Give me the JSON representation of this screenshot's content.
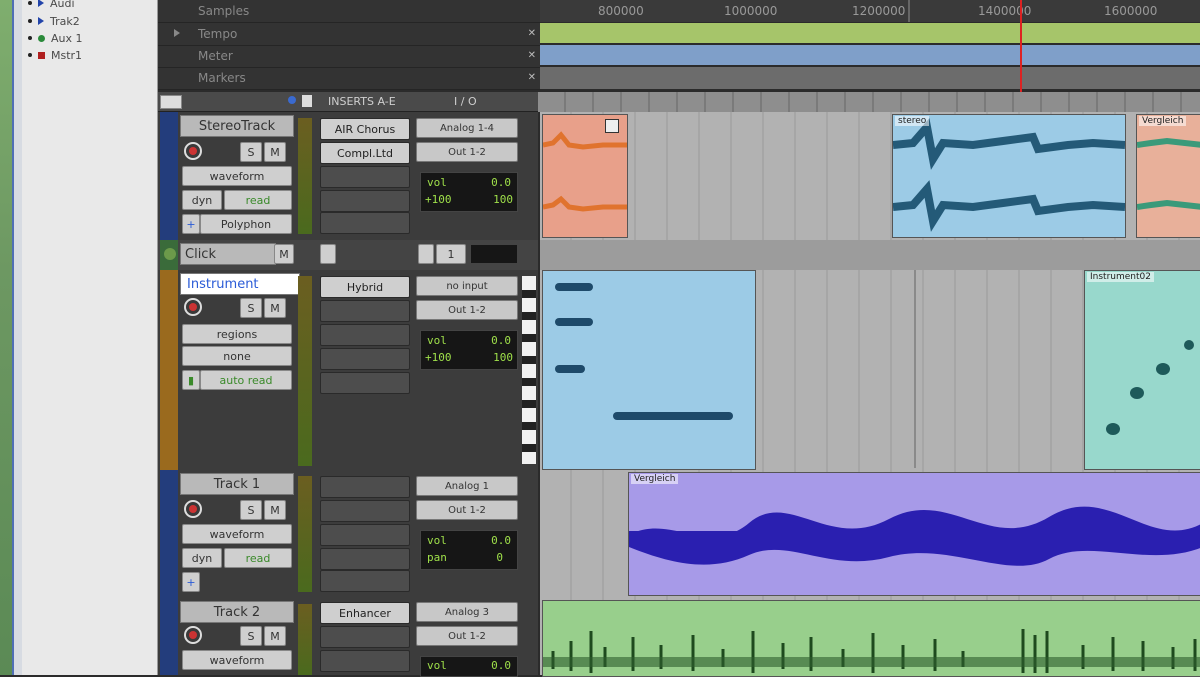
{
  "track_list": [
    {
      "label": "Audi",
      "color": "#2244aa"
    },
    {
      "label": "Trak2",
      "color": "#2244aa"
    },
    {
      "label": "Aux 1",
      "color": "#2a8a3a"
    },
    {
      "label": "Mstr1",
      "color": "#b02020"
    }
  ],
  "rulers": {
    "samples_label": "Samples",
    "tempo_label": "Tempo",
    "meter_label": "Meter",
    "markers_label": "Markers",
    "ticks": [
      "800000",
      "1000000",
      "1200000",
      "1400000",
      "1600000"
    ]
  },
  "columns": {
    "inserts": "INSERTS A-E",
    "io": "I / O"
  },
  "tracks": {
    "stereo": {
      "name": "StereoTrack",
      "view": "waveform",
      "automation": "read",
      "dyn": "dyn",
      "playlist": "Polyphon",
      "inserts": [
        "AIR Chorus",
        "Compl.Ltd"
      ],
      "input": "Analog 1-4",
      "output": "Out 1-2",
      "vol_label": "vol",
      "vol": "0.0",
      "pan_l": "+100",
      "pan_r": "100"
    },
    "click": {
      "name": "Click",
      "io_value": "1"
    },
    "instrument": {
      "name": "Instrument",
      "view": "regions",
      "view2": "none",
      "automation": "auto read",
      "inserts": [
        "Hybrid"
      ],
      "input": "no input",
      "output": "Out 1-2",
      "vol_label": "vol",
      "vol": "0.0",
      "pan_l": "+100",
      "pan_r": "100"
    },
    "track1": {
      "name": "Track 1",
      "view": "waveform",
      "automation": "read",
      "dyn": "dyn",
      "input": "Analog 1",
      "output": "Out 1-2",
      "vol_label": "vol",
      "vol": "0.0",
      "pan_label": "pan",
      "pan": "0"
    },
    "track2": {
      "name": "Track 2",
      "view": "waveform",
      "inserts": [
        "Enhancer"
      ],
      "input": "Analog 3",
      "output": "Out 1-2",
      "vol_label": "vol",
      "vol": "0.0"
    }
  },
  "regions": {
    "stereo_a": "stereo",
    "stereo_b": "Vergleich",
    "inst_b": "Instrument02",
    "track1": "Vergleich"
  },
  "colors": {
    "orange_region": "#e8a08a",
    "blue_region": "#9ccbe6",
    "teal_region": "#98d8cc",
    "purple_region": "#a79ae8",
    "green_region": "#98cf8c",
    "playhead": "#dd2222"
  }
}
